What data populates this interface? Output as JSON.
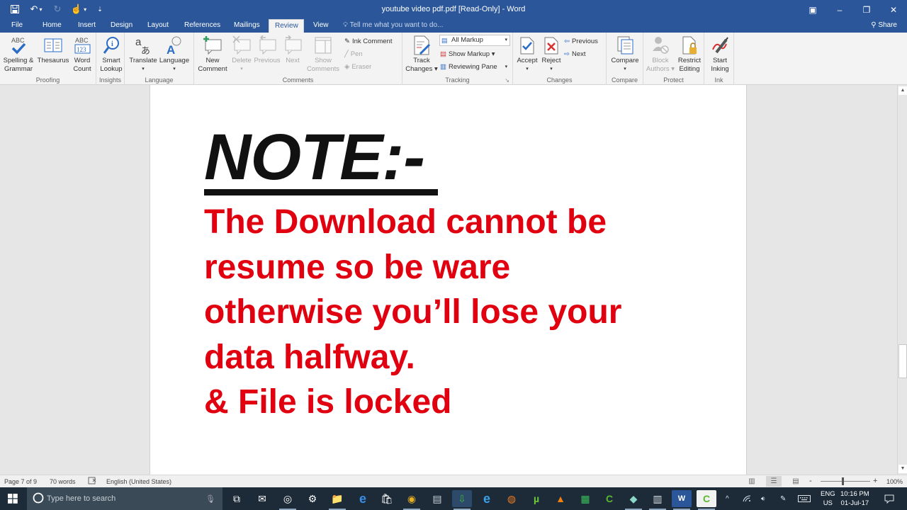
{
  "window": {
    "title": "youtube video pdf.pdf [Read-Only] - Word",
    "controls": {
      "ribbon_display": "▣",
      "minimize": "–",
      "restore": "❐",
      "close": "✕"
    }
  },
  "qat": {
    "save_icon": "💾",
    "undo_icon": "↶",
    "redo_icon": "↻",
    "touch_icon": "☝",
    "customize_icon": "⇣"
  },
  "tabs": [
    {
      "label": "File"
    },
    {
      "label": "Home"
    },
    {
      "label": "Insert"
    },
    {
      "label": "Design"
    },
    {
      "label": "Layout"
    },
    {
      "label": "References"
    },
    {
      "label": "Mailings"
    },
    {
      "label": "Review",
      "active": true
    },
    {
      "label": "View"
    }
  ],
  "tellme": {
    "icon": "♀",
    "placeholder": "Tell me what you want to do..."
  },
  "share": {
    "label": "Share",
    "icon": "👤"
  },
  "ribbon": {
    "proofing": {
      "label": "Proofing",
      "spelling": "Spelling &\nGrammar",
      "thesaurus": "Thesaurus",
      "word_count": "Word\nCount"
    },
    "insights": {
      "label": "Insights",
      "smart_lookup": "Smart\nLookup"
    },
    "language": {
      "label": "Language",
      "translate": "Translate",
      "language": "Language"
    },
    "comments": {
      "label": "Comments",
      "new_comment": "New\nComment",
      "delete": "Delete",
      "previous": "Previous",
      "next": "Next",
      "show_comments": "Show\nComments",
      "ink_comment": "Ink Comment",
      "pen": "Pen",
      "eraser": "Eraser"
    },
    "tracking": {
      "label": "Tracking",
      "track_changes": "Track\nChanges ▾",
      "markup_combo": "All Markup",
      "show_markup": "Show Markup ▾",
      "reviewing_pane": "Reviewing Pane",
      "launcher": "↘"
    },
    "changes": {
      "label": "Changes",
      "accept": "Accept",
      "reject": "Reject",
      "previous": "Previous",
      "next": "Next"
    },
    "compare": {
      "label": "Compare",
      "compare": "Compare"
    },
    "protect": {
      "label": "Protect",
      "block_authors": "Block\nAuthors ▾",
      "restrict_editing": "Restrict\nEditing"
    },
    "ink": {
      "label": "Ink",
      "start_inking": "Start\nInking"
    },
    "collapse_icon": "^"
  },
  "document": {
    "heading": "NOTE:-",
    "body": "The Download cannot be\nresume so be ware\notherwise you’ll lose your\ndata halfway.\n& File is locked",
    "cursor_icon": "I"
  },
  "statusbar": {
    "page": "Page 7 of 9",
    "words": "70 words",
    "proofing_icon": "📖",
    "language": "English (United States)",
    "zoom_minus": "-",
    "zoom_plus": "+",
    "zoom_level": "100%"
  },
  "taskbar": {
    "search_placeholder": "Type here to search",
    "apps": [
      {
        "name": "task-view",
        "glyph": "⧉"
      },
      {
        "name": "mail",
        "glyph": "✉"
      },
      {
        "name": "groove",
        "glyph": "◎"
      },
      {
        "name": "settings",
        "glyph": "⚙"
      },
      {
        "name": "file-explorer",
        "glyph": "📁"
      },
      {
        "name": "edge",
        "glyph": "e"
      },
      {
        "name": "store",
        "glyph": "🛍"
      },
      {
        "name": "chrome",
        "glyph": "◉"
      },
      {
        "name": "app-generic",
        "glyph": "▤"
      },
      {
        "name": "internet-download-manager",
        "glyph": "⇩"
      },
      {
        "name": "internet-explorer",
        "glyph": "e"
      },
      {
        "name": "firefox",
        "glyph": "◍"
      },
      {
        "name": "utorrent",
        "glyph": "µ"
      },
      {
        "name": "vlc",
        "glyph": "▲"
      },
      {
        "name": "app-green",
        "glyph": "▦"
      },
      {
        "name": "camtasia",
        "glyph": "C"
      },
      {
        "name": "app-teal",
        "glyph": "◆"
      },
      {
        "name": "app-document",
        "glyph": "▥"
      },
      {
        "name": "word",
        "glyph": "W"
      },
      {
        "name": "camtasia-recorder",
        "glyph": "C"
      }
    ],
    "tray": {
      "chevron": "^",
      "wifi": "📶",
      "volume": "🔊",
      "pen": "✎",
      "keyboard": "⌨",
      "lang_top": "ENG",
      "lang_bottom": "US",
      "time": "10:16 PM",
      "date": "01-Jul-17",
      "notifications": "🗨"
    }
  },
  "colors": {
    "word_blue": "#2b579a",
    "ribbon_bg": "#f3f3f3",
    "doc_text_red": "#e0000f",
    "taskbar": "#1d2b38"
  }
}
